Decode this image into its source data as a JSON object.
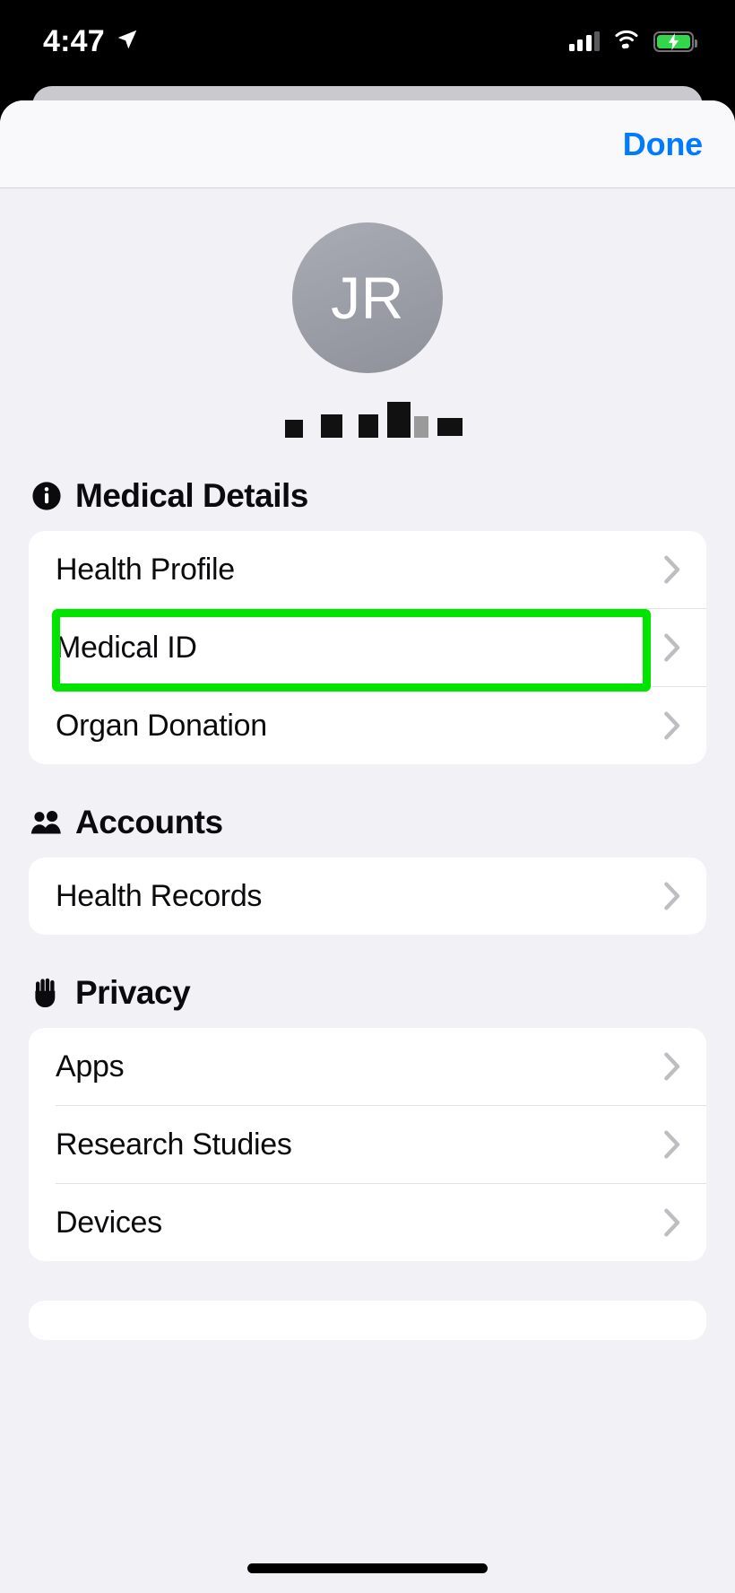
{
  "status_bar": {
    "time": "4:47",
    "location_icon": "location-arrow-icon",
    "cellular_icon": "cellular-bars-icon",
    "wifi_icon": "wifi-icon",
    "battery_icon": "battery-charging-icon",
    "battery_color": "#32D74B"
  },
  "nav": {
    "done_label": "Done"
  },
  "profile": {
    "initials": "JR",
    "name_redacted": true,
    "avatar_color": "#8E9199"
  },
  "sections": [
    {
      "id": "medical-details",
      "title": "Medical Details",
      "icon": "info-circle-icon",
      "rows": [
        {
          "label": "Health Profile",
          "chevron": "chevron-right-icon",
          "highlighted": false
        },
        {
          "label": "Medical ID",
          "chevron": "chevron-right-icon",
          "highlighted": true
        },
        {
          "label": "Organ Donation",
          "chevron": "chevron-right-icon",
          "highlighted": false
        }
      ]
    },
    {
      "id": "accounts",
      "title": "Accounts",
      "icon": "people-icon",
      "rows": [
        {
          "label": "Health Records",
          "chevron": "chevron-right-icon",
          "highlighted": false
        }
      ]
    },
    {
      "id": "privacy",
      "title": "Privacy",
      "icon": "hand-raised-icon",
      "rows": [
        {
          "label": "Apps",
          "chevron": "chevron-right-icon",
          "highlighted": false
        },
        {
          "label": "Research Studies",
          "chevron": "chevron-right-icon",
          "highlighted": false
        },
        {
          "label": "Devices",
          "chevron": "chevron-right-icon",
          "highlighted": false
        }
      ]
    }
  ],
  "highlight": {
    "color": "#00E400",
    "target_label": "Medical ID"
  }
}
